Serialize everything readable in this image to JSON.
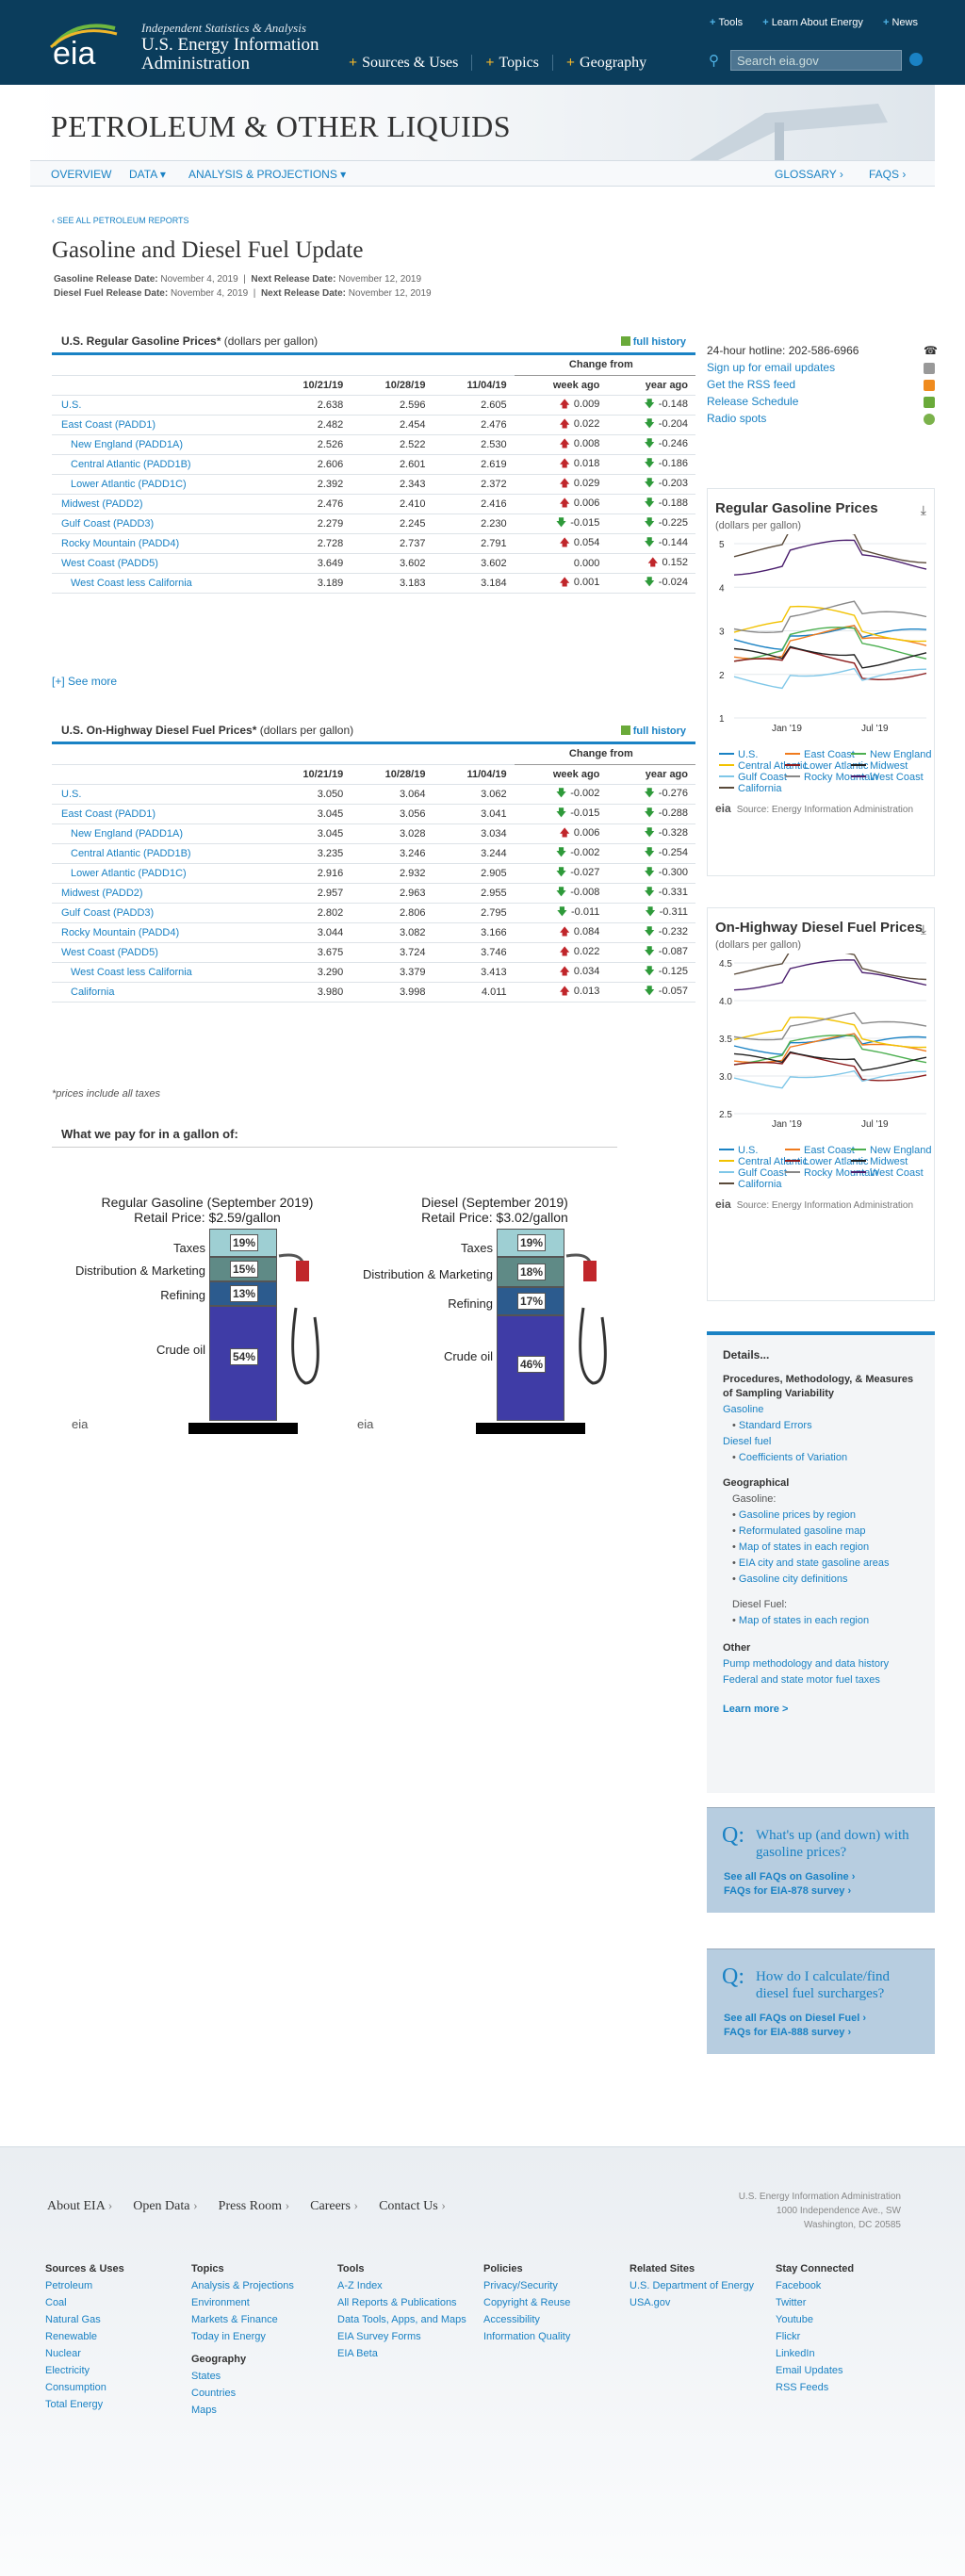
{
  "header": {
    "tag": "Independent Statistics & Analysis",
    "org1": "U.S. Energy Information",
    "org2": "Administration",
    "logo": "eia",
    "toplinks": [
      "Tools",
      "Learn About Energy",
      "News"
    ],
    "nav": [
      "Sources & Uses",
      "Topics",
      "Geography"
    ],
    "search_placeholder": "Search eia.gov"
  },
  "banner": {
    "title": "PETROLEUM & OTHER LIQUIDS",
    "subnav": [
      "OVERVIEW",
      "DATA ▾",
      "ANALYSIS & PROJECTIONS ▾",
      "GLOSSARY ›",
      "FAQS ›"
    ]
  },
  "page": {
    "crumb": "‹ SEE ALL PETROLEUM REPORTS",
    "title": "Gasoline and Diesel Fuel Update",
    "gas_release": "Gasoline Release Date:",
    "gas_date": "November 4, 2019",
    "next1": "Next Release Date:",
    "gas_next": "November 12, 2019",
    "diesel_release": "Diesel Fuel Release Date:",
    "diesel_date": "November 4, 2019",
    "next2": "Next Release Date:",
    "diesel_next": "November 12, 2019"
  },
  "gas_table": {
    "title": "U.S. Regular Gasoline Prices",
    "units": "(dollars per gallon)",
    "full_history": "full history",
    "change_from": "Change from",
    "cols": [
      "10/21/19",
      "10/28/19",
      "11/04/19",
      "week ago",
      "year ago"
    ],
    "rows": [
      [
        "U.S.",
        "2.638",
        "2.596",
        "2.605",
        "0.009",
        "-0.148"
      ],
      [
        "East Coast (PADD1)",
        "2.482",
        "2.454",
        "2.476",
        "0.022",
        "-0.204"
      ],
      [
        "New England (PADD1A)",
        "2.526",
        "2.522",
        "2.530",
        "0.008",
        "-0.246"
      ],
      [
        "Central Atlantic (PADD1B)",
        "2.606",
        "2.601",
        "2.619",
        "0.018",
        "-0.186"
      ],
      [
        "Lower Atlantic (PADD1C)",
        "2.392",
        "2.343",
        "2.372",
        "0.029",
        "-0.203"
      ],
      [
        "Midwest (PADD2)",
        "2.476",
        "2.410",
        "2.416",
        "0.006",
        "-0.188"
      ],
      [
        "Gulf Coast (PADD3)",
        "2.279",
        "2.245",
        "2.230",
        "-0.015",
        "-0.225"
      ],
      [
        "Rocky Mountain (PADD4)",
        "2.728",
        "2.737",
        "2.791",
        "0.054",
        "-0.144"
      ],
      [
        "West Coast (PADD5)",
        "3.649",
        "3.602",
        "3.602",
        "0.000",
        "0.152"
      ],
      [
        "West Coast less California",
        "3.189",
        "3.183",
        "3.184",
        "0.001",
        "-0.024"
      ]
    ],
    "see_more": "[+] See more"
  },
  "diesel_table": {
    "title": "U.S. On-Highway Diesel Fuel Prices",
    "units": "(dollars per gallon)",
    "full_history": "full history",
    "change_from": "Change from",
    "cols": [
      "10/21/19",
      "10/28/19",
      "11/04/19",
      "week ago",
      "year ago"
    ],
    "rows": [
      [
        "U.S.",
        "3.050",
        "3.064",
        "3.062",
        "-0.002",
        "-0.276"
      ],
      [
        "East Coast (PADD1)",
        "3.045",
        "3.056",
        "3.041",
        "-0.015",
        "-0.288"
      ],
      [
        "New England (PADD1A)",
        "3.045",
        "3.028",
        "3.034",
        "0.006",
        "-0.328"
      ],
      [
        "Central Atlantic (PADD1B)",
        "3.235",
        "3.246",
        "3.244",
        "-0.002",
        "-0.254"
      ],
      [
        "Lower Atlantic (PADD1C)",
        "2.916",
        "2.932",
        "2.905",
        "-0.027",
        "-0.300"
      ],
      [
        "Midwest (PADD2)",
        "2.957",
        "2.963",
        "2.955",
        "-0.008",
        "-0.331"
      ],
      [
        "Gulf Coast (PADD3)",
        "2.802",
        "2.806",
        "2.795",
        "-0.011",
        "-0.311"
      ],
      [
        "Rocky Mountain (PADD4)",
        "3.044",
        "3.082",
        "3.166",
        "0.084",
        "-0.232"
      ],
      [
        "West Coast (PADD5)",
        "3.675",
        "3.724",
        "3.746",
        "0.022",
        "-0.087"
      ],
      [
        "West Coast less California",
        "3.290",
        "3.379",
        "3.413",
        "0.034",
        "-0.125"
      ],
      [
        "California",
        "3.980",
        "3.998",
        "4.011",
        "0.013",
        "-0.057"
      ]
    ]
  },
  "note": "*prices include all taxes",
  "pay": {
    "title": "What we pay for in a gallon of:",
    "gas": {
      "t1": "Regular Gasoline (September 2019)",
      "t2": "Retail Price: $2.59/gallon",
      "labels": [
        "Taxes",
        "Distribution & Marketing",
        "Refining",
        "Crude oil"
      ],
      "pcts": [
        "19%",
        "15%",
        "13%",
        "54%"
      ]
    },
    "diesel": {
      "t1": "Diesel (September 2019)",
      "t2": "Retail Price: $3.02/gallon",
      "labels": [
        "Taxes",
        "Distribution & Marketing",
        "Refining",
        "Crude oil"
      ],
      "pcts": [
        "19%",
        "18%",
        "17%",
        "46%"
      ]
    }
  },
  "sidebar": {
    "hotline": "24-hour hotline: 202-586-6966",
    "links": [
      "Sign up for email updates",
      "Get the RSS feed",
      "Release Schedule",
      "Radio spots"
    ]
  },
  "chart_data": [
    {
      "type": "line",
      "title": "Regular Gasoline Prices",
      "subtitle": "(dollars per gallon)",
      "yticks": [
        "5",
        "4",
        "3",
        "2",
        "1"
      ],
      "ylim": [
        1,
        5
      ],
      "xticks": [
        "Jan '19",
        "Jul '19"
      ],
      "series": [
        {
          "name": "U.S.",
          "color": "#1a82c4"
        },
        {
          "name": "East Coast",
          "color": "#f07b1e"
        },
        {
          "name": "New England",
          "color": "#4caf50"
        },
        {
          "name": "Central Atlantic",
          "color": "#f2c200"
        },
        {
          "name": "Lower Atlantic",
          "color": "#8b1a1a"
        },
        {
          "name": "Midwest",
          "color": "#222222"
        },
        {
          "name": "Gulf Coast",
          "color": "#7fc7e8"
        },
        {
          "name": "Rocky Mountain",
          "color": "#888888"
        },
        {
          "name": "West Coast",
          "color": "#4b1f6e"
        },
        {
          "name": "California",
          "color": "#5a4a3a"
        }
      ],
      "source": "Source: Energy Information Administration"
    },
    {
      "type": "line",
      "title": "On-Highway Diesel Fuel Prices",
      "subtitle": "(dollars per gallon)",
      "yticks": [
        "4.5",
        "4.0",
        "3.5",
        "3.0",
        "2.5"
      ],
      "ylim": [
        2.5,
        4.5
      ],
      "xticks": [
        "Jan '19",
        "Jul '19"
      ],
      "series": [
        {
          "name": "U.S.",
          "color": "#1a82c4"
        },
        {
          "name": "East Coast",
          "color": "#f07b1e"
        },
        {
          "name": "New England",
          "color": "#4caf50"
        },
        {
          "name": "Central Atlantic",
          "color": "#f2c200"
        },
        {
          "name": "Lower Atlantic",
          "color": "#8b1a1a"
        },
        {
          "name": "Midwest",
          "color": "#222222"
        },
        {
          "name": "Gulf Coast",
          "color": "#7fc7e8"
        },
        {
          "name": "Rocky Mountain",
          "color": "#888888"
        },
        {
          "name": "West Coast",
          "color": "#4b1f6e"
        },
        {
          "name": "California",
          "color": "#5a4a3a"
        }
      ],
      "source": "Source: Energy Information Administration"
    }
  ],
  "details": {
    "title": "Details...",
    "h1": "Procedures, Methodology, & Measures of Sampling Variability",
    "gasoline": "Gasoline",
    "std_err": "Standard Errors",
    "diesel": "Diesel fuel",
    "coef": "Coefficients of Variation",
    "geo": "Geographical",
    "gas_lbl": "Gasoline:",
    "geo_gas": [
      "Gasoline prices by region",
      "Reformulated gasoline map",
      "Map of states in each region",
      "EIA city and state gasoline areas",
      "Gasoline city definitions"
    ],
    "diesel_lbl": "Diesel Fuel:",
    "geo_diesel": [
      "Map of states in each region"
    ],
    "other": "Other",
    "other_links": [
      "Pump methodology and data history",
      "Federal and state motor fuel taxes"
    ],
    "learn": "Learn more >"
  },
  "faq1": {
    "q": "Q:",
    "text": "What's up (and down) with gasoline prices?",
    "l1": "See all FAQs on Gasoline ›",
    "l2": "FAQs for EIA-878 survey ›"
  },
  "faq2": {
    "q": "Q:",
    "text": "How do I calculate/find diesel fuel surcharges?",
    "l1": "See all FAQs on Diesel Fuel ›",
    "l2": "FAQs for EIA-888 survey ›"
  },
  "footer": {
    "nav": [
      "About EIA",
      "Open Data",
      "Press Room",
      "Careers",
      "Contact Us"
    ],
    "addr": [
      "U.S. Energy Information Administration",
      "1000 Independence Ave., SW",
      "Washington, DC 20585"
    ],
    "cols": [
      {
        "h": "Sources & Uses",
        "items": [
          "Petroleum",
          "Coal",
          "Natural Gas",
          "Renewable",
          "Nuclear",
          "Electricity",
          "Consumption",
          "Total Energy"
        ]
      },
      {
        "h": "Topics",
        "items": [
          "Analysis & Projections",
          "Environment",
          "Markets & Finance",
          "Today in Energy"
        ],
        "h2": "Geography",
        "items2": [
          "States",
          "Countries",
          "Maps"
        ]
      },
      {
        "h": "Tools",
        "items": [
          "A-Z Index",
          "All Reports & Publications",
          "Data Tools, Apps, and Maps",
          "EIA Survey Forms",
          "EIA Beta"
        ]
      },
      {
        "h": "Policies",
        "items": [
          "Privacy/Security",
          "Copyright & Reuse",
          "Accessibility",
          "Information Quality"
        ]
      },
      {
        "h": "Related Sites",
        "items": [
          "U.S. Department of Energy",
          "USA.gov"
        ]
      },
      {
        "h": "Stay Connected",
        "items": [
          "Facebook",
          "Twitter",
          "Youtube",
          "Flickr",
          "LinkedIn",
          "Email Updates",
          "RSS Feeds"
        ]
      }
    ]
  }
}
